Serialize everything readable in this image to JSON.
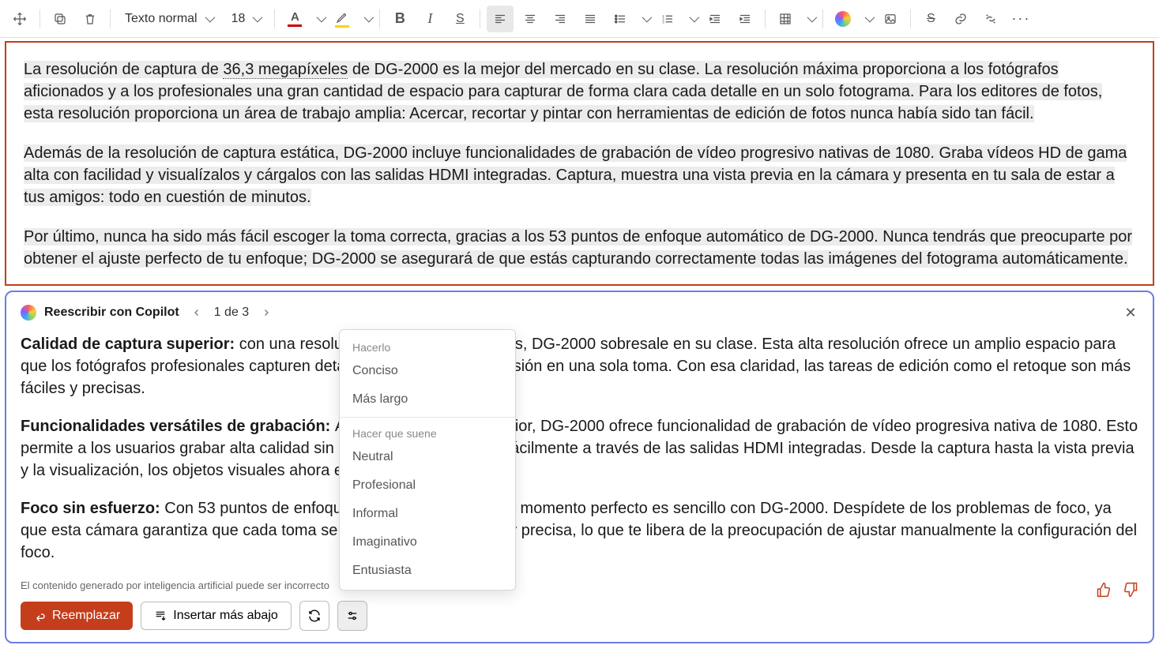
{
  "toolbar": {
    "style_label": "Texto normal",
    "font_size": "18"
  },
  "doc": {
    "p1_a": "La resolución de captura de ",
    "p1_link": "36,3 megapíxeles",
    "p1_b": " de DG-2000 es la mejor del mercado en su clase. La resolución máxima proporciona a los fotógrafos aficionados y a los profesionales una gran cantidad de espacio para capturar de forma clara cada detalle en un solo fotograma. Para los editores de fotos, esta resolución proporciona un área de trabajo amplia: Acercar, recortar y pintar con herramientas de edición de fotos nunca había sido tan fácil.",
    "p2": "Además de la resolución de captura estática, DG-2000 incluye funcionalidades de grabación de vídeo progresivo nativas de 1080. Graba vídeos HD de gama alta con facilidad y visualízalos y cárgalos con las salidas HDMI integradas. Captura, muestra una vista previa en la cámara y presenta en tu sala de estar a tus amigos: todo en cuestión de minutos.",
    "p3": "Por último, nunca ha sido más fácil escoger la toma correcta, gracias a los 53 puntos de enfoque automático de DG-2000. Nunca tendrás que preocuparte por obtener el ajuste perfecto de tu enfoque; DG-2000 se asegurará de que estás capturando correctamente todas las imágenes del fotograma automáticamente."
  },
  "copilot": {
    "title": "Reescribir con Copilot",
    "counter": "1 de 3",
    "s1_title": "Calidad de captura superior: ",
    "s1_body": "con una resolución de 24,2 megapíxeles, DG-2000 sobresale en su clase. Esta alta resolución ofrece un amplio espacio para que los fotógrafos profesionales capturen detalles complejos con precisión en una sola toma. Con esa claridad, las tareas de edición como el retoque son más fáciles y precisas.",
    "s2_title": "Funcionalidades versátiles de grabación: ",
    "s2_body": "Además de imagen superior, DG-2000 ofrece funcionalidad de grabación de vídeo progresiva nativa de 1080. Esto permite a los usuarios grabar alta calidad sin esfuerzo y compartirlos fácilmente a través de las salidas HDMI integradas. Desde la captura hasta la vista previa y la visualización, los objetos visuales ahora es más cómodo.",
    "s3_title": "Foco sin esfuerzo: ",
    "s3_body": "Con 53 puntos de enfoque automático, capturar el momento perfecto es sencillo con DG-2000. Despídete de los problemas de foco, ya que esta cámara garantiza que cada toma se capture de forma nítida y precisa, lo que te libera de la preocupación de ajustar manualmente la configuración del foco.",
    "disclaimer": "El contenido generado por inteligencia artificial puede ser incorrecto",
    "replace": "Reemplazar",
    "insert_below": "Insertar más abajo"
  },
  "tone_menu": {
    "section1": "Hacerlo",
    "concise": "Conciso",
    "longer": "Más largo",
    "section2": "Hacer que suene",
    "neutral": "Neutral",
    "professional": "Profesional",
    "informal": "Informal",
    "imaginative": "Imaginativo",
    "enthusiast": "Entusiasta"
  }
}
